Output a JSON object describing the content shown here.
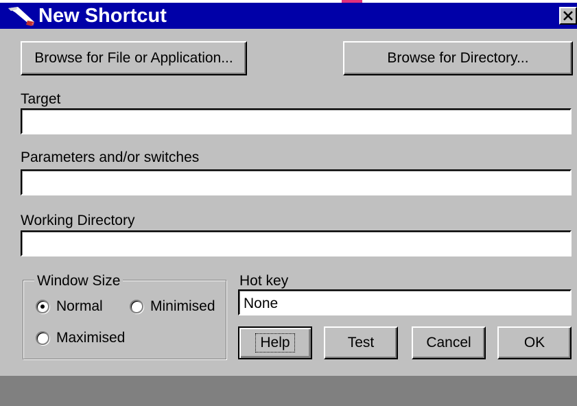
{
  "window": {
    "title": "New Shortcut",
    "app_icon": "shortcut-arrow-icon",
    "close_icon": "close-icon"
  },
  "buttons": {
    "browse_file": "Browse for File or Application...",
    "browse_directory": "Browse for Directory...",
    "help": "Help",
    "test": "Test",
    "cancel": "Cancel",
    "ok": "OK"
  },
  "fields": {
    "target": {
      "label": "Target",
      "value": ""
    },
    "parameters": {
      "label": "Parameters and/or switches",
      "value": ""
    },
    "working_directory": {
      "label": "Working Directory",
      "value": ""
    },
    "hot_key": {
      "label": "Hot key",
      "value": "None"
    }
  },
  "window_size": {
    "legend": "Window Size",
    "options": [
      {
        "label": "Normal",
        "selected": true
      },
      {
        "label": "Minimised",
        "selected": false
      },
      {
        "label": "Maximised",
        "selected": false
      }
    ]
  },
  "colors": {
    "title_bar": "#0000a8",
    "face": "#c0c0c0",
    "status_bar": "#808080"
  }
}
